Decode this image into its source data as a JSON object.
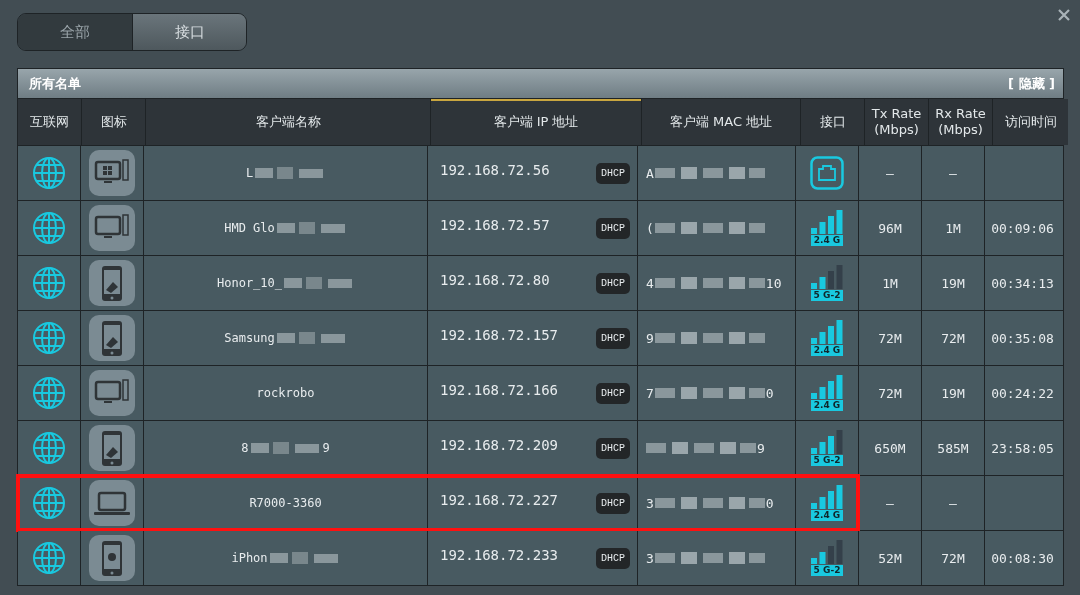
{
  "tabs": [
    {
      "label": "全部",
      "selected": false
    },
    {
      "label": "接口",
      "selected": true
    }
  ],
  "panel": {
    "title": "所有名单",
    "hide_link": "[ 隐藏 ]"
  },
  "table": {
    "columns": [
      {
        "label": "互联网",
        "sorted": false
      },
      {
        "label": "图标",
        "sorted": false
      },
      {
        "label": "客户端名称",
        "sorted": false
      },
      {
        "label": "客户端 IP 地址",
        "sorted": true
      },
      {
        "label": "客户端 MAC 地址",
        "sorted": false
      },
      {
        "label": "接口",
        "sorted": false
      },
      {
        "label": "Tx Rate (Mbps)",
        "sorted": false
      },
      {
        "label": "Rx Rate (Mbps)",
        "sorted": false
      },
      {
        "label": "访问时间",
        "sorted": false
      }
    ],
    "rows": [
      {
        "device": {
          "kind": "windows-pc"
        },
        "name": "L",
        "name_end": "",
        "name_redacted": true,
        "ip": "192.168.72.56",
        "ip_badge": "DHCP",
        "mac": "A",
        "mac_end": "",
        "interface": {
          "kind": "wired"
        },
        "tx": "–",
        "rx": "–",
        "time": "",
        "highlighted": false
      },
      {
        "device": {
          "kind": "pc"
        },
        "name": "HMD Glo",
        "name_end": "",
        "name_redacted": true,
        "ip": "192.168.72.57",
        "ip_badge": "DHCP",
        "mac": "(",
        "mac_end": "",
        "interface": {
          "kind": "wifi-strong",
          "band": "2.4 G"
        },
        "tx": "96M",
        "rx": "1M",
        "time": "00:09:06",
        "highlighted": false
      },
      {
        "device": {
          "kind": "phone"
        },
        "name": "Honor_10_",
        "name_end": "",
        "name_redacted": true,
        "ip": "192.168.72.80",
        "ip_badge": "DHCP",
        "mac": "4",
        "mac_end": "10",
        "interface": {
          "kind": "wifi-weak",
          "band": "5 G-2"
        },
        "tx": "1M",
        "rx": "19M",
        "time": "00:34:13",
        "highlighted": false
      },
      {
        "device": {
          "kind": "phone"
        },
        "name": "Samsung",
        "name_end": "",
        "name_redacted": true,
        "ip": "192.168.72.157",
        "ip_badge": "DHCP",
        "mac": "9",
        "mac_end": "",
        "interface": {
          "kind": "wifi-strong",
          "band": "2.4 G"
        },
        "tx": "72M",
        "rx": "72M",
        "time": "00:35:08",
        "highlighted": false
      },
      {
        "device": {
          "kind": "pc"
        },
        "name": "rockrobo",
        "name_end": "",
        "name_redacted": false,
        "ip": "192.168.72.166",
        "ip_badge": "DHCP",
        "mac": "7",
        "mac_end": "0",
        "interface": {
          "kind": "wifi-strong",
          "band": "2.4 G"
        },
        "tx": "72M",
        "rx": "19M",
        "time": "00:24:22",
        "highlighted": false
      },
      {
        "device": {
          "kind": "phone"
        },
        "name": "8",
        "name_end": "9",
        "name_redacted": true,
        "ip": "192.168.72.209",
        "ip_badge": "DHCP",
        "mac": "",
        "mac_end": "9",
        "interface": {
          "kind": "wifi-good",
          "band": "5 G-2"
        },
        "tx": "650M",
        "rx": "585M",
        "time": "23:58:05",
        "highlighted": false
      },
      {
        "device": {
          "kind": "laptop"
        },
        "name": "R7000-3360",
        "name_end": "",
        "name_redacted": false,
        "ip": "192.168.72.227",
        "ip_badge": "DHCP",
        "mac": "3",
        "mac_end": "0",
        "interface": {
          "kind": "wifi-strong",
          "band": "2.4 G"
        },
        "tx": "–",
        "rx": "–",
        "time": "",
        "highlighted": true
      },
      {
        "device": {
          "kind": "apple-phone"
        },
        "name": "iPhon",
        "name_end": "",
        "name_redacted": true,
        "ip": "192.168.72.233",
        "ip_badge": "DHCP",
        "mac": "3",
        "mac_end": "",
        "interface": {
          "kind": "wifi-weak",
          "band": "5 G-2"
        },
        "tx": "52M",
        "rx": "72M",
        "time": "00:08:30",
        "highlighted": false
      }
    ]
  }
}
